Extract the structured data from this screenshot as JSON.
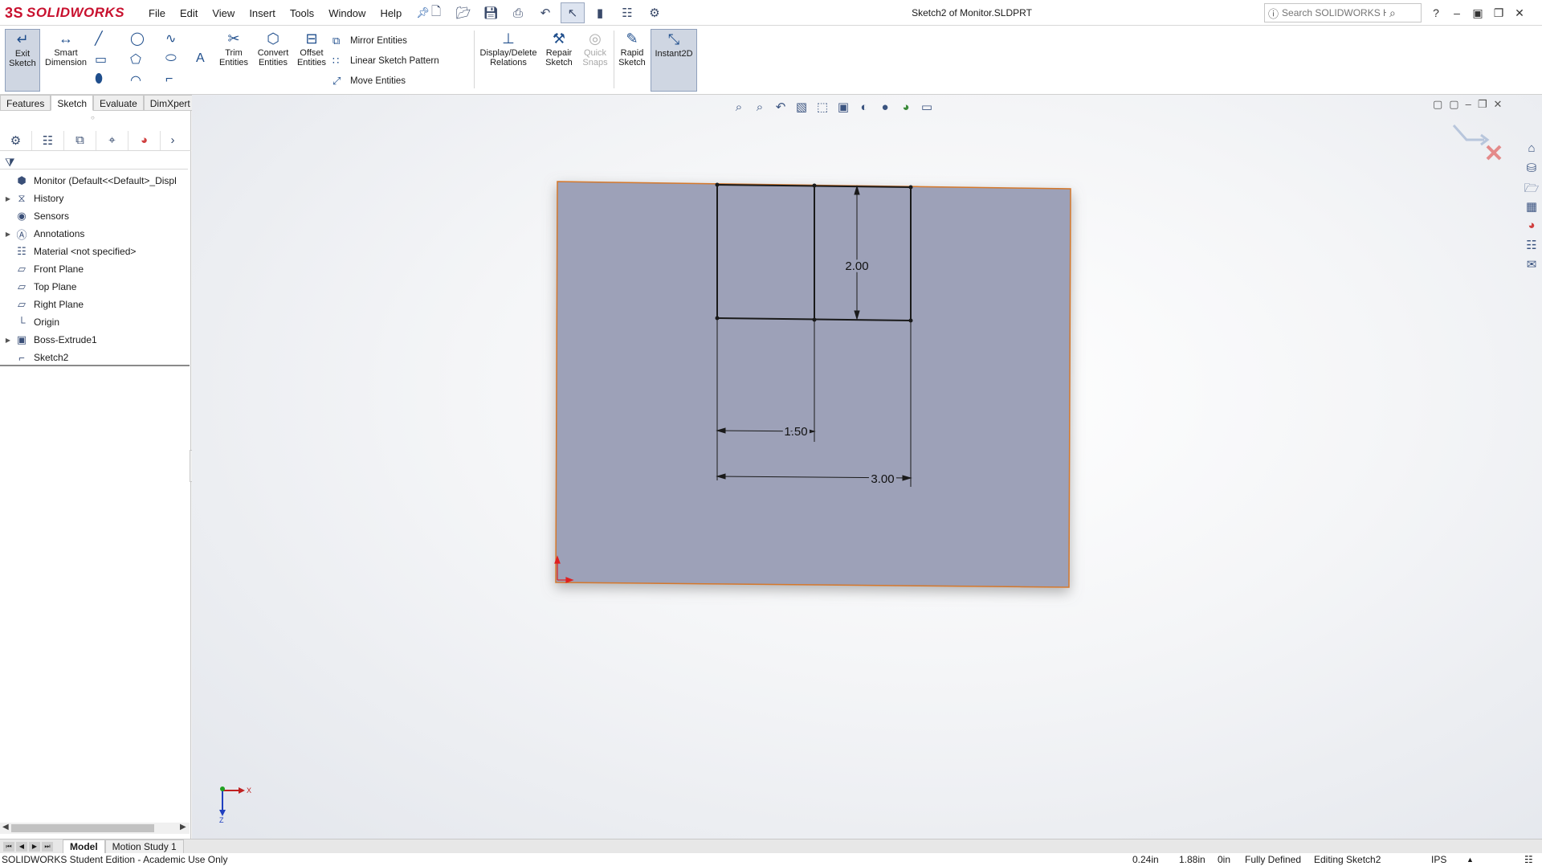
{
  "app": {
    "brand": "SOLIDWORKS",
    "brand_mark": "3S",
    "doc_title": "Sketch2 of Monitor.SLDPRT"
  },
  "menu": [
    "File",
    "Edit",
    "View",
    "Insert",
    "Tools",
    "Window",
    "Help"
  ],
  "search": {
    "placeholder": "Search SOLIDWORKS Help"
  },
  "commands": {
    "exit_sketch": "Exit Sketch",
    "smart_dimension": "Smart Dimension",
    "trim": "Trim Entities",
    "convert": "Convert Entities",
    "offset": "Offset Entities",
    "mirror": "Mirror Entities",
    "linear_pattern": "Linear Sketch Pattern",
    "move": "Move Entities",
    "display_delete": "Display/Delete Relations",
    "repair": "Repair Sketch",
    "quick_snaps": "Quick Snaps",
    "rapid_sketch": "Rapid Sketch",
    "instant2d": "Instant2D"
  },
  "tabs": [
    "Features",
    "Sketch",
    "Evaluate",
    "DimXpert"
  ],
  "active_tab": "Sketch",
  "tree": [
    {
      "label": "Monitor  (Default<<Default>_Displ",
      "icon": "part-icon",
      "expand": false
    },
    {
      "label": "History",
      "icon": "history-icon",
      "expand": true
    },
    {
      "label": "Sensors",
      "icon": "sensors-icon",
      "expand": false
    },
    {
      "label": "Annotations",
      "icon": "annotations-icon",
      "expand": true
    },
    {
      "label": "Material <not specified>",
      "icon": "material-icon",
      "expand": false
    },
    {
      "label": "Front Plane",
      "icon": "plane-icon",
      "expand": false
    },
    {
      "label": "Top Plane",
      "icon": "plane-icon",
      "expand": false
    },
    {
      "label": "Right Plane",
      "icon": "plane-icon",
      "expand": false
    },
    {
      "label": "Origin",
      "icon": "origin-icon",
      "expand": false
    },
    {
      "label": "Boss-Extrude1",
      "icon": "extrude-icon",
      "expand": true
    },
    {
      "label": "Sketch2",
      "icon": "sketch-icon",
      "expand": false
    }
  ],
  "sketch": {
    "dim_height": "2.00",
    "dim_half_width": "1.50",
    "dim_width": "3.00",
    "face_color": "#9da1b8",
    "edge_color": "#d4782a"
  },
  "triad": {
    "x_label": "X",
    "z_label": "Z"
  },
  "bottom_tabs": [
    "Model",
    "Motion Study 1"
  ],
  "status": {
    "left": "SOLIDWORKS Student Edition - Academic Use Only",
    "x": "0.24in",
    "y": "1.88in",
    "z": "0in",
    "state": "Fully Defined",
    "editing": "Editing Sketch2",
    "units": "IPS"
  }
}
